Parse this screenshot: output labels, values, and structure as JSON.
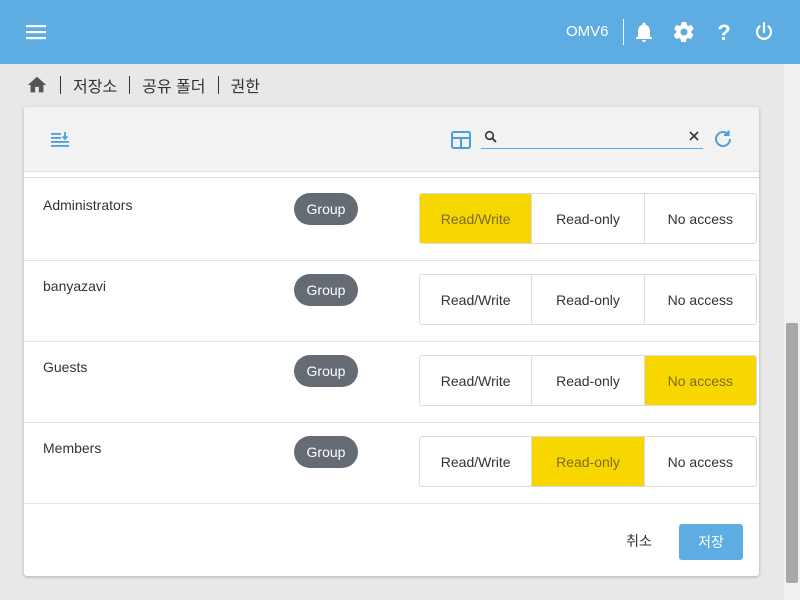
{
  "header": {
    "brand": "OMV6",
    "icons": [
      "menu-icon",
      "bell-icon",
      "gear-icon",
      "help-icon",
      "power-icon"
    ],
    "color": "#5dade2"
  },
  "breadcrumb": {
    "items": [
      "저장소",
      "공유 폴더",
      "권한"
    ]
  },
  "toolbar": {
    "search_placeholder": "",
    "search_value": ""
  },
  "permissions": {
    "columns": [
      "Read/Write",
      "Read-only",
      "No access"
    ],
    "rows": [
      {
        "name": "Administrators",
        "type": "Group",
        "selected": "Read/Write"
      },
      {
        "name": "banyazavi",
        "type": "Group",
        "selected": ""
      },
      {
        "name": "Guests",
        "type": "Group",
        "selected": "No access"
      },
      {
        "name": "Members",
        "type": "Group",
        "selected": "Read-only"
      }
    ]
  },
  "actions": {
    "cancel": "취소",
    "save": "저장"
  },
  "colors": {
    "accent": "#5dade2",
    "selected": "#f8d700",
    "chip": "#656b72"
  }
}
